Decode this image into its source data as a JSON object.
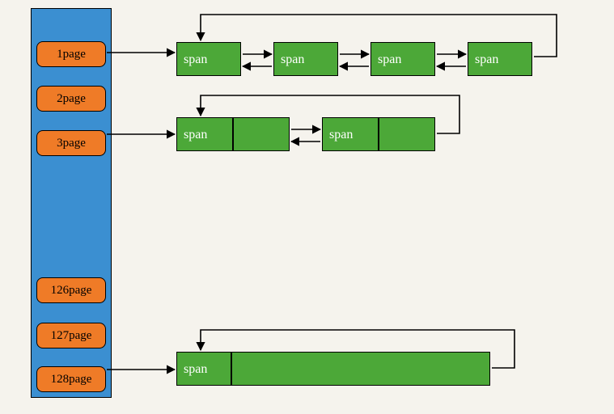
{
  "sidebar": {
    "pages": [
      {
        "label": "1page"
      },
      {
        "label": "2page"
      },
      {
        "label": "3page"
      },
      {
        "label": "126page"
      },
      {
        "label": "127page"
      },
      {
        "label": "128page"
      }
    ]
  },
  "rows": [
    {
      "spans": [
        "span",
        "span",
        "span",
        "span"
      ]
    },
    {
      "spans": [
        "span",
        "span"
      ]
    },
    {
      "spans": [
        "span"
      ]
    }
  ],
  "description": "Page buffer / span linked-list diagram. Left blue panel holds page entries (1page..3page, 126page..128page). Each active page points to a sequence of green span blocks linked forward and backward; a feedback arrow returns from the last span to the first of the row."
}
